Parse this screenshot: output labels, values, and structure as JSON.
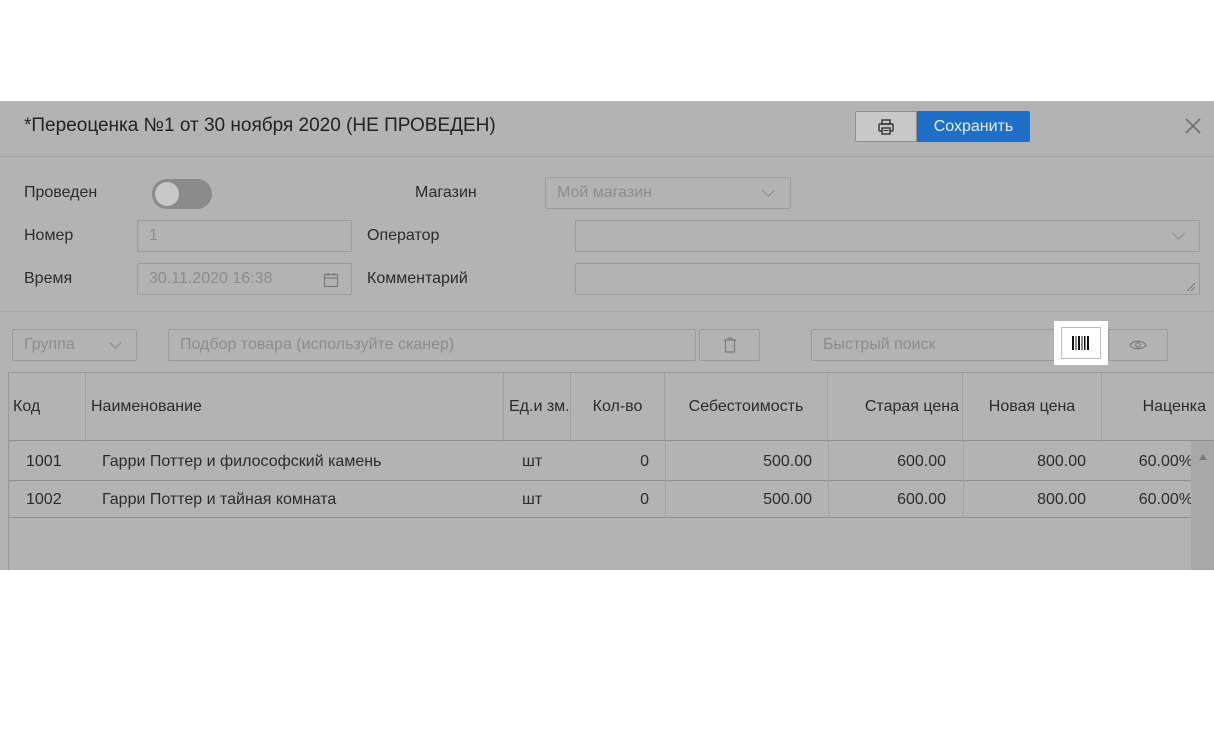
{
  "dialog": {
    "title": "*Переоценка №1 от 30 ноября 2020 (НЕ ПРОВЕДЕН)",
    "save_label": "Сохранить",
    "print_icon": "printer-icon",
    "close_icon": "close-icon"
  },
  "form": {
    "posted_label": "Проведен",
    "posted_value": false,
    "number_label": "Номер",
    "number_value": "1",
    "time_label": "Время",
    "time_value": "30.11.2020 16:38",
    "store_label": "Магазин",
    "store_value": "Мой магазин",
    "operator_label": "Оператор",
    "operator_value": "",
    "comment_label": "Комментарий",
    "comment_value": ""
  },
  "toolbar": {
    "group_label": "Группа",
    "product_placeholder": "Подбор товара (используйте сканер)",
    "quick_search_placeholder": "Быстрый поиск",
    "delete_icon": "trash-icon",
    "barcode_icon": "barcode-icon",
    "view_icon": "eye-icon"
  },
  "table": {
    "columns": [
      "Код",
      "Наименование",
      "Ед.и зм.",
      "Кол-во",
      "Себестоимость",
      "Старая цена",
      "Новая цена",
      "Наценка"
    ],
    "rows": [
      [
        "1001",
        "Гарри Поттер и философский камень",
        "шт",
        "0",
        "500.00",
        "600.00",
        "800.00",
        "60.00%"
      ],
      [
        "1002",
        "Гарри Поттер и тайная комната",
        "шт",
        "0",
        "500.00",
        "600.00",
        "800.00",
        "60.00%"
      ]
    ]
  },
  "colors": {
    "accent": "#1f6fc8",
    "overlay": "#b3b3b3"
  }
}
